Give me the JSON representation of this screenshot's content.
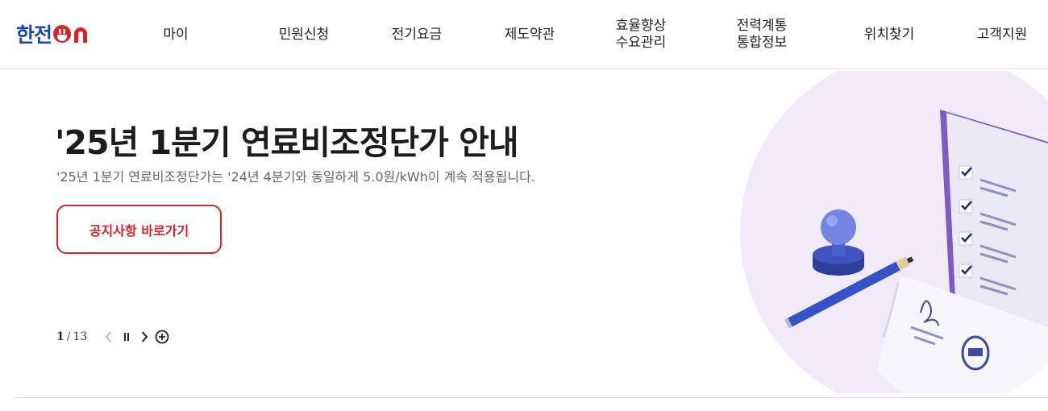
{
  "brand": {
    "logo_text": "한전",
    "logo_suffix": "ON",
    "logo_color": "#1b4aa8",
    "accent_color": "#d8232a"
  },
  "nav": {
    "items": [
      {
        "label": "마이"
      },
      {
        "label": "민원신청"
      },
      {
        "label": "전기요금"
      },
      {
        "label": "제도약관"
      },
      {
        "line1": "효율향상",
        "line2": "수요관리"
      },
      {
        "line1": "전력계통",
        "line2": "통합정보"
      },
      {
        "label": "위치찾기"
      },
      {
        "label": "고객지원"
      }
    ]
  },
  "hero": {
    "title": "'25년 1분기 연료비조정단가 안내",
    "description": "'25년 1분기 연료비조정단가는 '24년 4분기와 동일하게 5.0원/kWh이 계속 적용됩니다.",
    "cta_label": "공지사항 바로가기"
  },
  "pager": {
    "current": "1",
    "separator": "/",
    "total": "13"
  },
  "icons": {
    "prev": "chevron-left-icon",
    "pause": "pause-icon",
    "next": "chevron-right-icon",
    "more": "plus-circle-icon"
  }
}
